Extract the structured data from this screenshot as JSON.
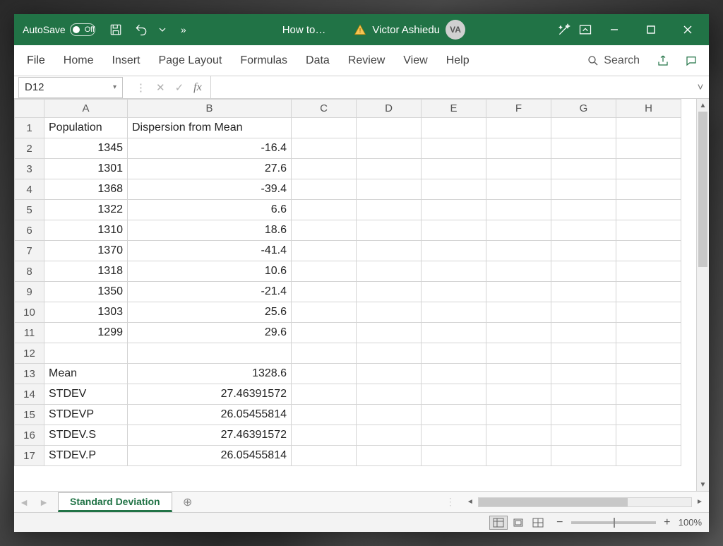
{
  "titlebar": {
    "autosave_label": "AutoSave",
    "autosave_state": "Off",
    "overflow": "»",
    "filename": "How to…",
    "username": "Victor Ashiedu",
    "avatar_initials": "VA"
  },
  "ribbon": {
    "tabs": [
      "File",
      "Home",
      "Insert",
      "Page Layout",
      "Formulas",
      "Data",
      "Review",
      "View",
      "Help"
    ],
    "search_label": "Search"
  },
  "formula_bar": {
    "name_box": "D12",
    "fx_label": "fx",
    "formula": ""
  },
  "columns": [
    "A",
    "B",
    "C",
    "D",
    "E",
    "F",
    "G",
    "H"
  ],
  "rows": [
    {
      "n": "1",
      "a": "Population",
      "b": "Dispersion from Mean",
      "a_bold": true,
      "b_bold": true,
      "a_align": "left",
      "b_align": "left"
    },
    {
      "n": "2",
      "a": "1345",
      "b": "-16.4",
      "a_align": "right",
      "b_align": "right"
    },
    {
      "n": "3",
      "a": "1301",
      "b": "27.6",
      "a_align": "right",
      "b_align": "right"
    },
    {
      "n": "4",
      "a": "1368",
      "b": "-39.4",
      "a_align": "right",
      "b_align": "right"
    },
    {
      "n": "5",
      "a": "1322",
      "b": "6.6",
      "a_align": "right",
      "b_align": "right"
    },
    {
      "n": "6",
      "a": "1310",
      "b": "18.6",
      "a_align": "right",
      "b_align": "right"
    },
    {
      "n": "7",
      "a": "1370",
      "b": "-41.4",
      "a_align": "right",
      "b_align": "right"
    },
    {
      "n": "8",
      "a": "1318",
      "b": "10.6",
      "a_align": "right",
      "b_align": "right"
    },
    {
      "n": "9",
      "a": "1350",
      "b": "-21.4",
      "a_align": "right",
      "b_align": "right"
    },
    {
      "n": "10",
      "a": "1303",
      "b": "25.6",
      "a_align": "right",
      "b_align": "right"
    },
    {
      "n": "11",
      "a": "1299",
      "b": "29.6",
      "a_align": "right",
      "b_align": "right"
    },
    {
      "n": "12",
      "a": "",
      "b": ""
    },
    {
      "n": "13",
      "a": "Mean",
      "b": "1328.6",
      "a_align": "left",
      "b_align": "right"
    },
    {
      "n": "14",
      "a": "STDEV",
      "b": "27.46391572",
      "a_align": "left",
      "b_align": "right"
    },
    {
      "n": "15",
      "a": "STDEVP",
      "b": "26.05455814",
      "a_align": "left",
      "b_align": "right"
    },
    {
      "n": "16",
      "a": "STDEV.S",
      "b": "27.46391572",
      "a_align": "left",
      "b_align": "right"
    },
    {
      "n": "17",
      "a": "STDEV.P",
      "b": "26.05455814",
      "a_align": "left",
      "b_align": "right"
    }
  ],
  "tabstrip": {
    "sheet_name": "Standard Deviation",
    "add_label": "⊕"
  },
  "statusbar": {
    "zoom": "100%"
  }
}
